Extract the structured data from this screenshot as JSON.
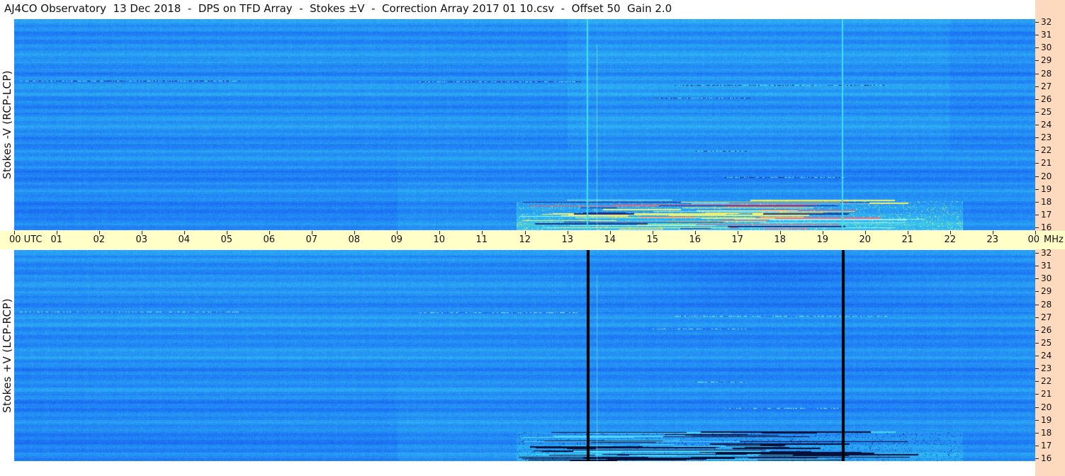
{
  "window": {
    "title": "AJ4CO Observatory  13 Dec 2018  -  DPS on TFD Array  -  Stokes ±V  -  Correction Array 2017 01 10.csv  -  Offset 50  Gain 2.0"
  },
  "chart_data": [
    {
      "type": "heatmap",
      "panel": "top",
      "ylabel": "Stokes -V (RCP-LCP)",
      "x_range_utc_hours": [
        0,
        24
      ],
      "y_range_mhz": [
        16,
        32
      ],
      "y_ticks": [
        "32",
        "31",
        "30",
        "29",
        "28",
        "27",
        "26",
        "25",
        "24",
        "23",
        "22",
        "21",
        "20",
        "19",
        "18",
        "17",
        "16"
      ],
      "colormap": [
        "#0a1a6e",
        "#1b6ef5",
        "#33c7f2",
        "#e8f060",
        "#ff3050"
      ],
      "features": [
        {
          "kind": "vertical_line",
          "utc_hour": 13.45,
          "color": "#3fe0e8"
        },
        {
          "kind": "vertical_line",
          "utc_hour": 19.45,
          "color": "#3fe0e8"
        },
        {
          "kind": "burst",
          "utc_start": 11.8,
          "utc_end": 22.3,
          "mhz_low": 16,
          "mhz_high": 18.2
        }
      ]
    },
    {
      "type": "heatmap",
      "panel": "bottom",
      "ylabel": "Stokes +V (LCP-RCP)",
      "x_range_utc_hours": [
        0,
        24
      ],
      "y_range_mhz": [
        16,
        32
      ],
      "y_ticks": [
        "32",
        "31",
        "30",
        "29",
        "28",
        "27",
        "26",
        "25",
        "24",
        "23",
        "22",
        "21",
        "20",
        "19",
        "18",
        "17",
        "16"
      ],
      "colormap": [
        "#0a1a6e",
        "#1b6ef5",
        "#33c7f2",
        "#e8f060",
        "#ff3050"
      ],
      "features": [
        {
          "kind": "vertical_line",
          "utc_hour": 13.45,
          "color": "#000000"
        },
        {
          "kind": "vertical_line",
          "utc_hour": 19.45,
          "color": "#000000"
        },
        {
          "kind": "burst",
          "utc_start": 11.8,
          "utc_end": 22.3,
          "mhz_low": 16,
          "mhz_high": 18.2
        }
      ]
    }
  ],
  "time_axis": {
    "labels": [
      "00 UTC",
      "01",
      "02",
      "03",
      "04",
      "05",
      "06",
      "07",
      "08",
      "09",
      "10",
      "11",
      "12",
      "13",
      "14",
      "15",
      "16",
      "17",
      "18",
      "19",
      "20",
      "21",
      "22",
      "23",
      "00"
    ],
    "unit": "MHz"
  }
}
